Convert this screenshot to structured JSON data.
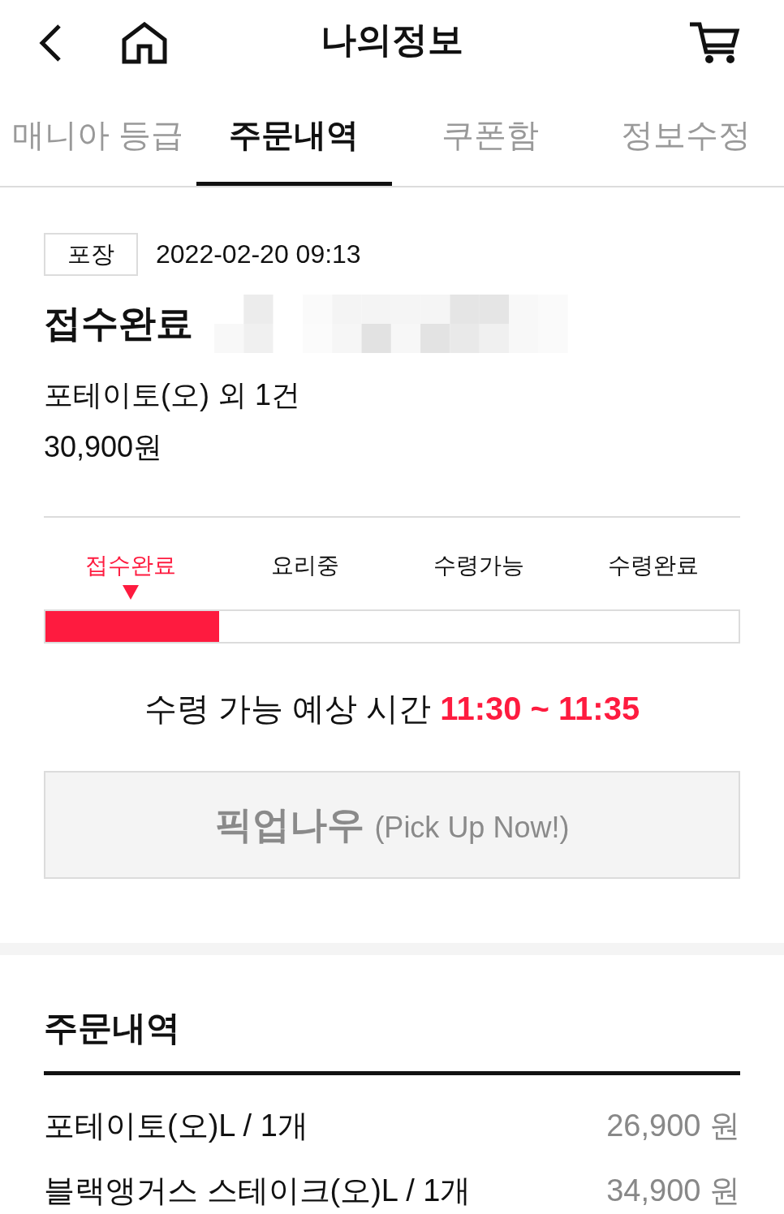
{
  "header": {
    "title": "나의정보"
  },
  "tabs": [
    {
      "label": "매니아 등급",
      "selected": false
    },
    {
      "label": "주문내역",
      "selected": true
    },
    {
      "label": "쿠폰함",
      "selected": false
    },
    {
      "label": "정보수정",
      "selected": false
    }
  ],
  "order": {
    "type": "포장",
    "datetime": "2022-02-20 09:13",
    "status": "접수완료",
    "summary": "포테이토(오) 외 1건",
    "total": "30,900원"
  },
  "progress": {
    "steps": [
      {
        "label": "접수완료",
        "selected": true
      },
      {
        "label": "요리중",
        "selected": false
      },
      {
        "label": "수령가능",
        "selected": false
      },
      {
        "label": "수령완료",
        "selected": false
      }
    ],
    "level": 0.25
  },
  "pickup_estimate": {
    "label": "수령 가능 예상 시간",
    "time": "11:30 ~ 11:35"
  },
  "pickup_button": {
    "label": "픽업나우",
    "sublabel": "(Pick Up Now!)",
    "disabled": true
  },
  "order_details": {
    "title": "주문내역",
    "items": [
      {
        "name": "포테이토(오)L / 1개",
        "price": "26,900 원"
      },
      {
        "name": "블랙앵거스 스테이크(오)L / 1개",
        "price": "34,900 원"
      }
    ]
  }
}
